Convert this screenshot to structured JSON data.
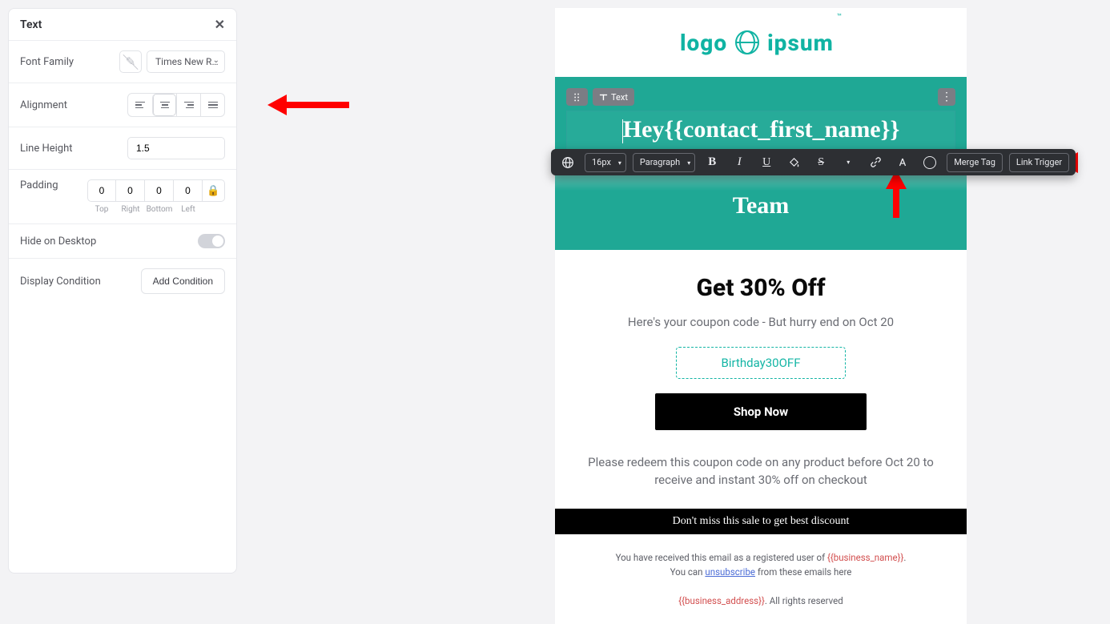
{
  "panel": {
    "title": "Text",
    "fontFamilyLabel": "Font Family",
    "fontFamilyValue": "Times New R…",
    "alignmentLabel": "Alignment",
    "lineHeightLabel": "Line Height",
    "lineHeightValue": "1.5",
    "paddingLabel": "Padding",
    "padding": {
      "top": "0",
      "right": "0",
      "bottom": "0",
      "left": "0"
    },
    "paddingCaptions": {
      "top": "Top",
      "right": "Right",
      "bottom": "Bottom",
      "left": "Left"
    },
    "hideDesktopLabel": "Hide on Desktop",
    "displayConditionLabel": "Display Condition",
    "addConditionLabel": "Add Condition"
  },
  "rtbar": {
    "fontSize": "16px",
    "paragraph": "Paragraph",
    "mergeTag": "Merge Tag",
    "linkTrigger": "Link Trigger"
  },
  "email": {
    "logo": {
      "left": "logo",
      "right": "ipsum"
    },
    "blockTag": "Text",
    "heroHey": "Hey{{contact_first_name}}",
    "heroTeam": "Team",
    "promoTitle": "Get 30% Off",
    "promoSub": "Here's your coupon code - But hurry end on Oct 20",
    "coupon": "Birthday30OFF",
    "shopNow": "Shop Now",
    "redeem": "Please redeem this coupon code on any product before Oct 20 to receive and instant 30% off on checkout",
    "blackbar": "Don't miss this sale to get best discount",
    "footer1a": "You have received this email as a registered user of ",
    "footer1b": "{{business_name}}",
    "footer1c": ".",
    "footer2a": "You can ",
    "footer2link": "unsubscribe",
    "footer2b": " from these emails here",
    "footer3a": "{{business_address}}",
    "footer3b": ". All rights reserved"
  }
}
